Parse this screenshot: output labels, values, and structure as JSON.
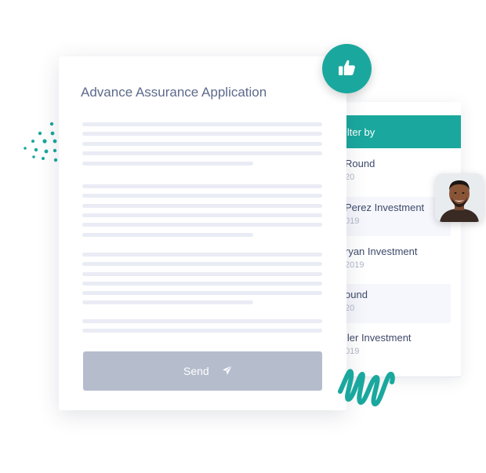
{
  "document": {
    "title": "Advance Assurance Application",
    "send_label": "Send"
  },
  "filter": {
    "header": "ilter by",
    "items": [
      {
        "name": "Round",
        "year": "20"
      },
      {
        "name": "Perez Investment",
        "year": "019"
      },
      {
        "name": "ryan Investment",
        "year": "2019"
      },
      {
        "name": "ound",
        "year": "20"
      },
      {
        "name": "ller Investment",
        "year": "019"
      }
    ]
  },
  "colors": {
    "accent": "#1aa89e",
    "button": "#b5bccc",
    "title": "#5d6a8c",
    "placeholder_line": "#eaecf5"
  },
  "icons": [
    "thumbs-up-icon",
    "send-plane-icon",
    "avatar",
    "dot-cluster",
    "squiggle"
  ]
}
